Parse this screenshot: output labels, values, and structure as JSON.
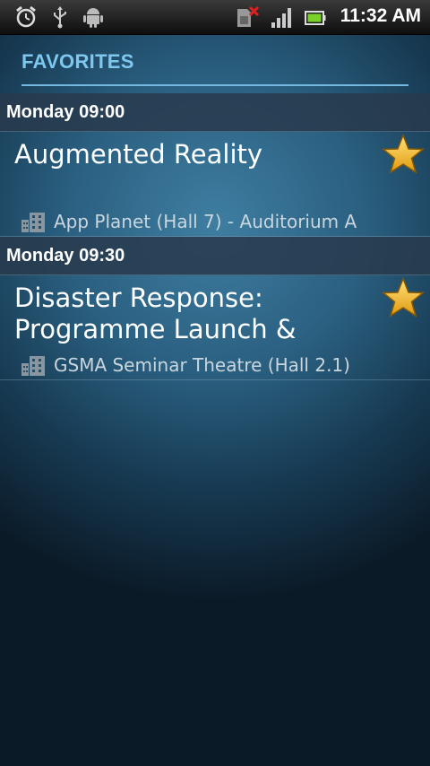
{
  "status_bar": {
    "time": "11:32 AM",
    "icons": [
      "alarm-icon",
      "usb-icon",
      "android-debug-icon",
      "no-sim-icon",
      "signal-icon",
      "battery-icon"
    ]
  },
  "header": {
    "title": "FAVORITES",
    "accent_color": "#7ec8f0"
  },
  "sections": [
    {
      "time_label": "Monday 09:00",
      "item": {
        "title": "Augmented Reality",
        "location": "App Planet (Hall 7) - Auditorium A",
        "favorited": true
      }
    },
    {
      "time_label": "Monday 09:30",
      "item": {
        "title": "Disaster Response: Programme Launch &",
        "location": "GSMA Seminar Theatre (Hall 2.1)",
        "favorited": true
      }
    }
  ]
}
